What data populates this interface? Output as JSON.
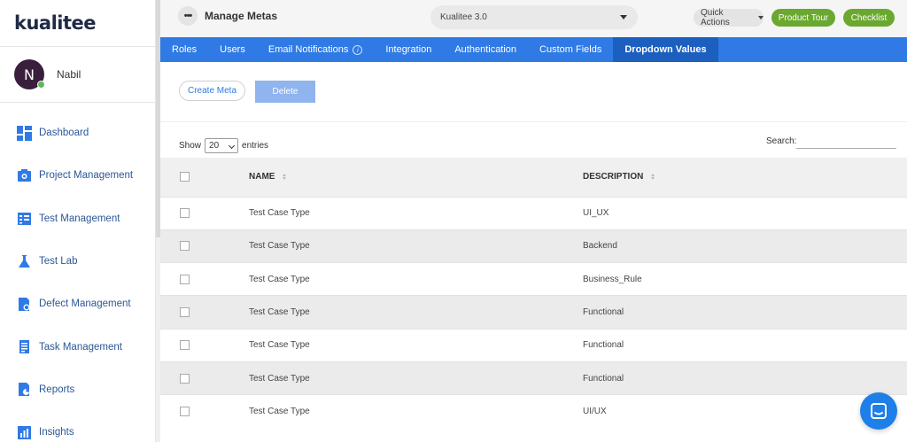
{
  "app": {
    "logo_text": "kualitee"
  },
  "user": {
    "initial": "N",
    "name": "Nabil"
  },
  "sidebar": {
    "items": [
      {
        "label": "Dashboard",
        "icon": "dashboard-icon"
      },
      {
        "label": "Project Management",
        "icon": "project-icon"
      },
      {
        "label": "Test Management",
        "icon": "test-management-icon"
      },
      {
        "label": "Test Lab",
        "icon": "flask-icon"
      },
      {
        "label": "Defect Management",
        "icon": "defect-icon"
      },
      {
        "label": "Task Management",
        "icon": "task-icon"
      },
      {
        "label": "Reports",
        "icon": "reports-icon"
      },
      {
        "label": "Insights",
        "icon": "insights-icon"
      }
    ]
  },
  "header": {
    "title": "Manage Metas",
    "project": "Kualitee 3.0",
    "quick_actions": "Quick Actions",
    "product_tour": "Product Tour",
    "checklist": "Checklist"
  },
  "tabs": [
    {
      "label": "Roles",
      "active": false
    },
    {
      "label": "Users",
      "active": false
    },
    {
      "label": "Email Notifications",
      "active": false,
      "info": true
    },
    {
      "label": "Integration",
      "active": false
    },
    {
      "label": "Authentication",
      "active": false
    },
    {
      "label": "Custom Fields",
      "active": false
    },
    {
      "label": "Dropdown Values",
      "active": true
    }
  ],
  "actions": {
    "create_label": "Create Meta",
    "delete_label": "Delete"
  },
  "table_controls": {
    "show_label": "Show",
    "page_size": "20",
    "entries_label": "entries",
    "search_label": "Search:"
  },
  "table": {
    "columns": [
      "NAME",
      "DESCRIPTION"
    ],
    "rows": [
      {
        "name": "Test Case Type",
        "description": "UI_UX"
      },
      {
        "name": "Test Case Type",
        "description": "Backend"
      },
      {
        "name": "Test Case Type",
        "description": "Business_Rule"
      },
      {
        "name": "Test Case Type",
        "description": "Functional"
      },
      {
        "name": "Test Case Type",
        "description": "Functional"
      },
      {
        "name": "Test Case Type",
        "description": "Functional"
      },
      {
        "name": "Test Case Type",
        "description": "UI/UX"
      }
    ]
  },
  "colors": {
    "tab_bar": "#2f7ae5",
    "tab_active": "#1d5fbf",
    "green_button": "#6aa82f",
    "chat_button": "#1e7fe8"
  }
}
